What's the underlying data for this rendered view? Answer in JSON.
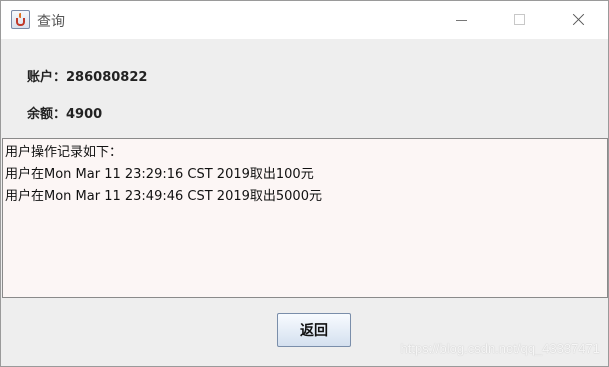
{
  "window": {
    "title": "查询"
  },
  "info": {
    "account_label": "账户：",
    "account_value": "286080822",
    "balance_label": "余额：",
    "balance_value": "4900"
  },
  "log": {
    "lines": [
      "用户操作记录如下：",
      "用户在Mon Mar 11 23:29:16 CST 2019取出100元",
      "用户在Mon Mar 11 23:49:46 CST 2019取出5000元"
    ]
  },
  "buttons": {
    "back_label": "返回"
  },
  "watermark": "https://blog.csdn.net/qq_43337471",
  "icons": {
    "app": "java-cup-icon",
    "minimize": "minimize-icon",
    "maximize": "maximize-icon",
    "close": "close-icon"
  }
}
